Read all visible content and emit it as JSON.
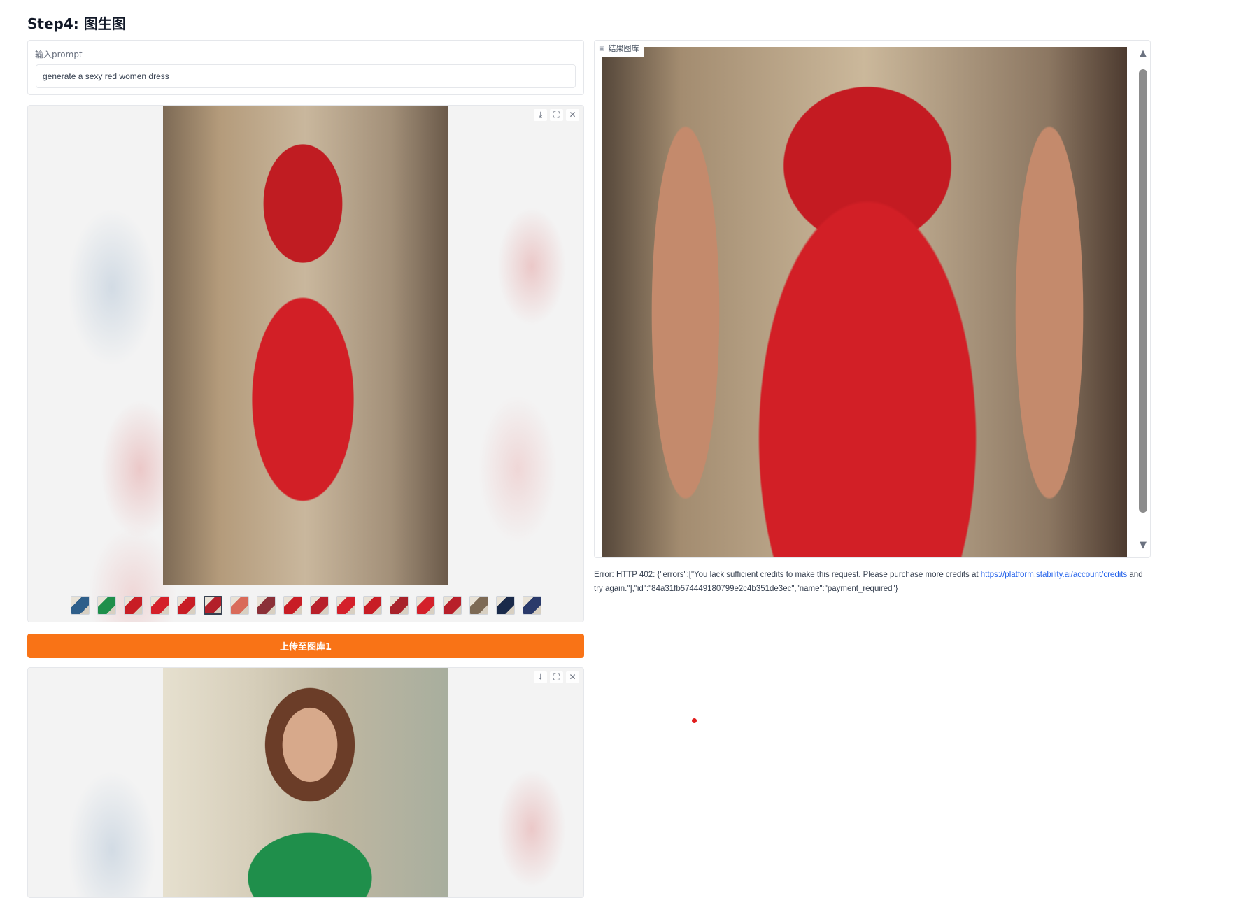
{
  "heading": "Step4: 图生图",
  "prompt": {
    "label": "输入prompt",
    "value": "generate a sexy red women dress"
  },
  "gallery_tools": {
    "download_icon": "download-icon",
    "fullscreen_icon": "fullscreen-icon",
    "close_icon": "close-icon"
  },
  "thumbnails": {
    "count": 18,
    "selected_index": 5,
    "colors": [
      "#2f5f8a",
      "#1f8f4b",
      "#c81d25",
      "#d4202a",
      "#c81d25",
      "#b3202a",
      "#d96b5a",
      "#8b3038",
      "#c81d25",
      "#b81f2a",
      "#d4202a",
      "#c81d25",
      "#a8222a",
      "#d4202a",
      "#b81f2a",
      "#7d6a55",
      "#1a2a4a",
      "#2a3a6a"
    ]
  },
  "upload_button": "上传至图库1",
  "result": {
    "label": "结果图库",
    "label_icon": "gallery-icon"
  },
  "error": {
    "prefix": "Error: HTTP 402: {\"errors\":[\"You lack sufficient credits to make this request. Please purchase more credits at ",
    "link": "https://platform.stability.ai/account/credits",
    "suffix": " and try again.\"],\"id\":\"84a31fb574449180799e2c4b351de3ec\",\"name\":\"payment_required\"}"
  },
  "colors": {
    "accent": "#f97316",
    "link": "#2563eb"
  }
}
